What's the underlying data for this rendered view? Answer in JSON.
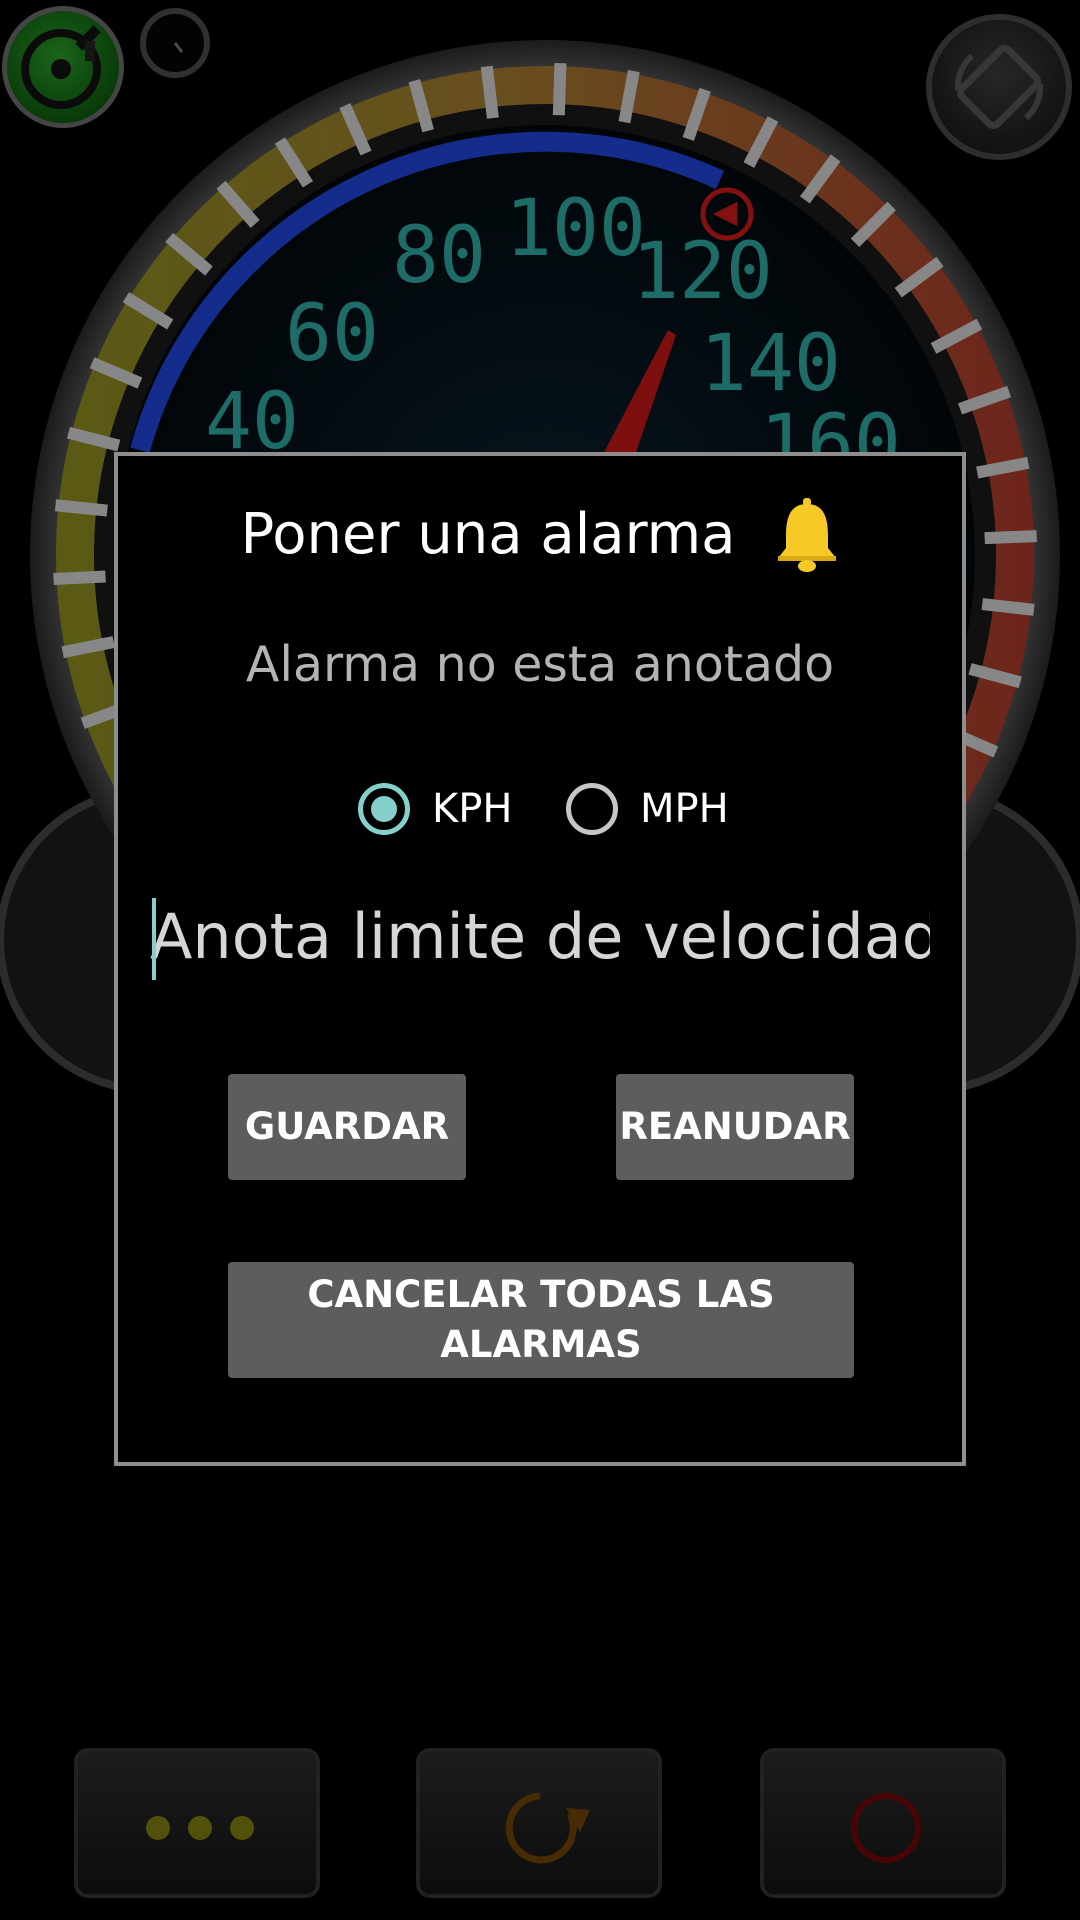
{
  "gauge": {
    "speed_labels": [
      "40",
      "60",
      "80",
      "100",
      "120",
      "140",
      "160"
    ],
    "alarm_marker_color": "#cc1a1a",
    "needle_color": "#c01818",
    "accent_blue": "#1f46d8",
    "digit_color": "#2fa7a0"
  },
  "dialog": {
    "title": "Poner una alarma",
    "title_icon": "bell-icon",
    "status": "Alarma no esta anotado",
    "units": [
      {
        "label": "KPH",
        "checked": true
      },
      {
        "label": "MPH",
        "checked": false
      }
    ],
    "input_placeholder": "Anota limite de velocidad",
    "buttons": {
      "save": "GUARDAR",
      "resume": "REANUDAR",
      "cancel_all": "CANCELAR TODAS LAS ALARMAS"
    },
    "accent_color": "#85d0cc"
  },
  "top_controls": {
    "gps": "satellite-icon",
    "compass": "compass-icon",
    "rotate": "rotate-screen-icon"
  },
  "bottom_controls": [
    {
      "icon": "more-dots-icon",
      "color": "#8a8a10"
    },
    {
      "icon": "reset-icon",
      "color": "#7a4a08"
    },
    {
      "icon": "record-icon",
      "color": "#7a0a0a"
    }
  ]
}
